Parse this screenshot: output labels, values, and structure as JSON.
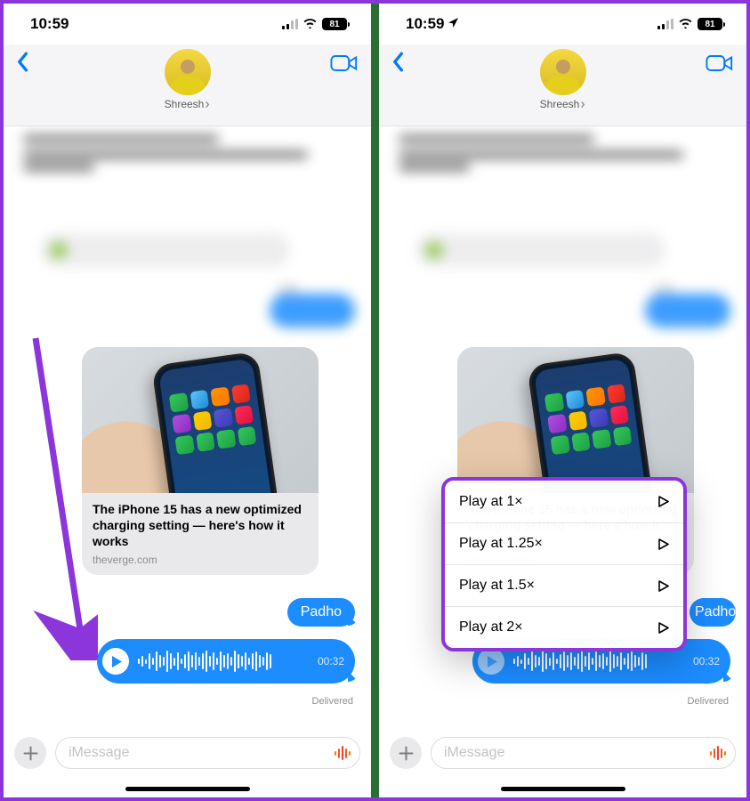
{
  "status": {
    "time": "10:59",
    "battery": "81"
  },
  "header": {
    "contact": "Shreesh"
  },
  "link": {
    "title": "The iPhone 15 has a new optimized charging setting — here's how it works",
    "source": "theverge.com"
  },
  "messages": {
    "padho": "Padho",
    "audio_duration": "00:32",
    "delivered": "Delivered"
  },
  "input": {
    "placeholder": "iMessage"
  },
  "speed_menu": [
    {
      "label": "Play at 1×"
    },
    {
      "label": "Play at 1.25×"
    },
    {
      "label": "Play at 1.5×"
    },
    {
      "label": "Play at 2×"
    }
  ]
}
